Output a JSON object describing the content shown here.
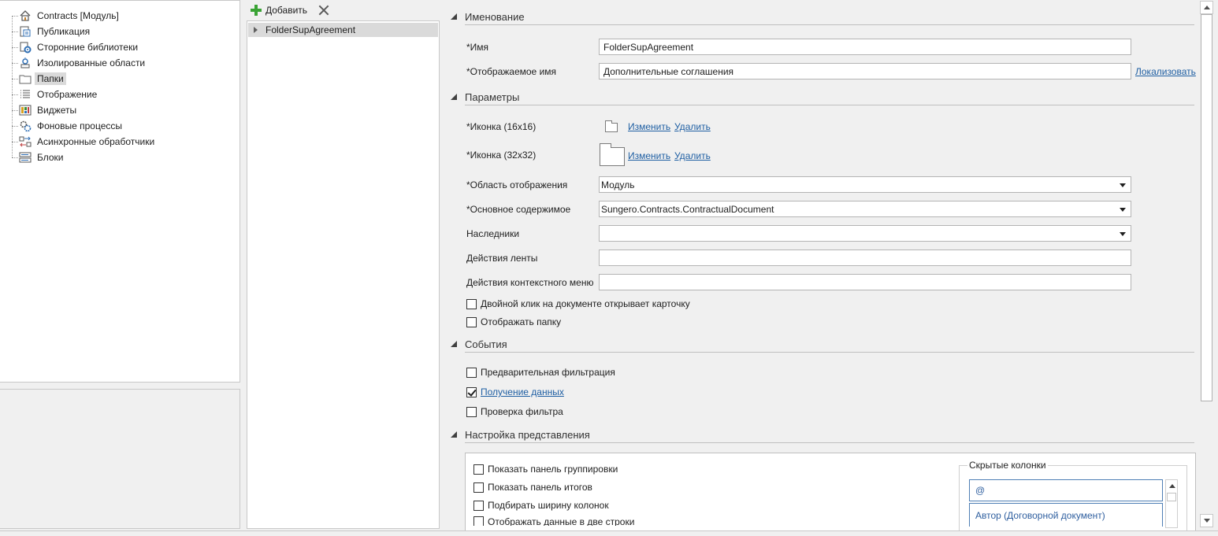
{
  "tree": {
    "items": [
      {
        "label": "Contracts [Модуль]",
        "icon": "home-icon"
      },
      {
        "label": "Публикация",
        "icon": "publication-icon"
      },
      {
        "label": "Сторонние библиотеки",
        "icon": "library-gear-icon"
      },
      {
        "label": "Изолированные области",
        "icon": "isolated-area-icon"
      },
      {
        "label": "Папки",
        "icon": "folder-icon"
      },
      {
        "label": "Отображение",
        "icon": "list-icon"
      },
      {
        "label": "Виджеты",
        "icon": "widgets-icon"
      },
      {
        "label": "Фоновые процессы",
        "icon": "gears-icon"
      },
      {
        "label": "Асинхронные обработчики",
        "icon": "async-handlers-icon"
      },
      {
        "label": "Блоки",
        "icon": "blocks-icon"
      }
    ],
    "selected_index": 4
  },
  "middle": {
    "add_label": "Добавить",
    "items": [
      "FolderSupAgreement"
    ]
  },
  "sections": {
    "naming": "Именование",
    "params": "Параметры",
    "events": "События",
    "view": "Настройка представления"
  },
  "naming": {
    "name_label": "*Имя",
    "name_value": "FolderSupAgreement",
    "display_label": "*Отображаемое имя",
    "display_value": "Дополнительные соглашения",
    "localize_link": "Локализовать"
  },
  "params": {
    "icon16_label": "*Иконка (16x16)",
    "icon32_label": "*Иконка (32x32)",
    "change_link": "Изменить",
    "delete_link": "Удалить",
    "area_label": "*Область отображения",
    "area_value": "Модуль",
    "content_label": "*Основное содержимое",
    "content_value": "Sungero.Contracts.ContractualDocument",
    "heirs_label": "Наследники",
    "heirs_value": "",
    "ribbon_label": "Действия ленты",
    "ribbon_value": "",
    "context_label": "Действия контекстного меню",
    "context_value": "",
    "dblclick_label": "Двойной клик на документе открывает карточку",
    "dblclick_checked": false,
    "show_folder_label": "Отображать папку",
    "show_folder_checked": false
  },
  "events": {
    "prefilter_label": "Предварительная фильтрация",
    "prefilter_checked": false,
    "getdata_label": "Получение данных",
    "getdata_checked": true,
    "checkfilter_label": "Проверка фильтра",
    "checkfilter_checked": false
  },
  "view": {
    "group_panel": "Показать панель группировки",
    "totals_panel": "Показать панель итогов",
    "fit_columns": "Подбирать ширину колонок",
    "two_lines": "Отображать данные в две строки",
    "hidden_columns_title": "Скрытые колонки",
    "hidden_input_value": "@",
    "hidden_items": [
      "Автор (Договорной документ)"
    ]
  },
  "colors": {
    "link": "#1f5fa3",
    "selection": "#dadada",
    "add_icon": "#3aa335"
  }
}
